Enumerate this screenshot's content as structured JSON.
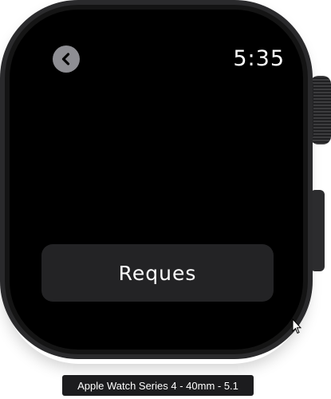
{
  "watch": {
    "time": "5:35",
    "back_icon": "chevron-left-icon",
    "request_button_label": "Reques"
  },
  "simulator": {
    "device_label": "Apple Watch Series 4 - 40mm - 5.1"
  },
  "colors": {
    "screen": "#000000",
    "case": "#2a2a2c",
    "button_bg": "#232325",
    "back_button_bg": "#8e8e93",
    "text": "#ffffff"
  }
}
